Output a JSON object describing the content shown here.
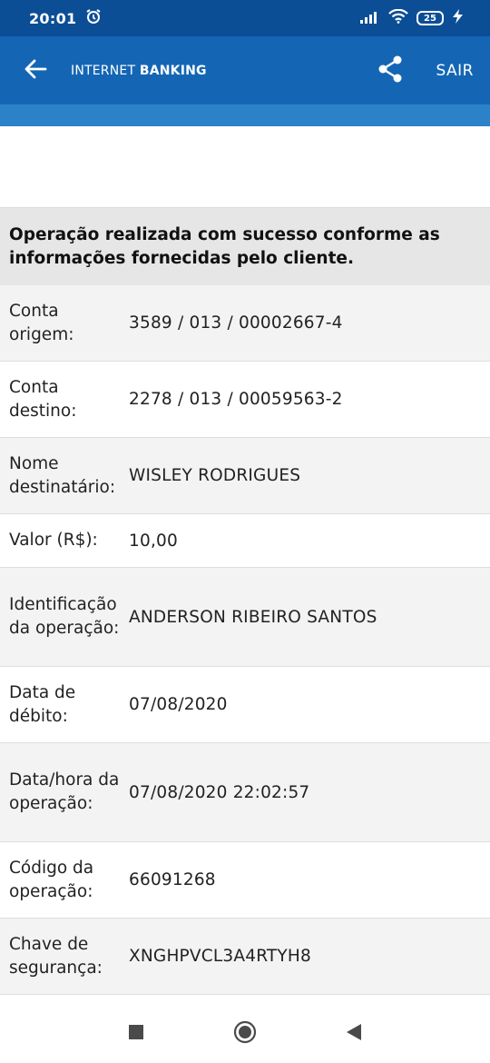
{
  "status_bar": {
    "time": "20:01",
    "battery_level": "25",
    "icons": [
      "alarm-icon",
      "signal-icon",
      "wifi-icon",
      "battery-icon",
      "charging-icon"
    ]
  },
  "app_bar": {
    "title_light": "INTERNET ",
    "title_bold": "BANKING",
    "exit_label": "SAIR",
    "colors": {
      "status_bar": "#0b4e96",
      "app_bar": "#1466b5",
      "accent_strip": "#2b82c9"
    }
  },
  "receipt": {
    "message": "Operação realizada com sucesso conforme as informações fornecidas pelo cliente.",
    "rows": [
      {
        "label": "Conta origem:",
        "value": "3589 / 013 / 00002667-4"
      },
      {
        "label": "Conta destino:",
        "value": "2278 / 013 / 00059563-2"
      },
      {
        "label": "Nome destinatário:",
        "value": "WISLEY RODRIGUES"
      },
      {
        "label": "Valor (R$):",
        "value": "10,00"
      },
      {
        "label": "Identificação da operação:",
        "value": "ANDERSON RIBEIRO SANTOS"
      },
      {
        "label": "Data de débito:",
        "value": "07/08/2020"
      },
      {
        "label": "Data/hora da operação:",
        "value": "07/08/2020 22:02:57"
      },
      {
        "label": "Código da operação:",
        "value": "66091268"
      },
      {
        "label": "Chave de segurança:",
        "value": "XNGHPVCL3A4RTYH8"
      }
    ]
  },
  "nav_bar": {
    "buttons": [
      "recents-square-icon",
      "home-circle-icon",
      "back-triangle-icon"
    ]
  }
}
